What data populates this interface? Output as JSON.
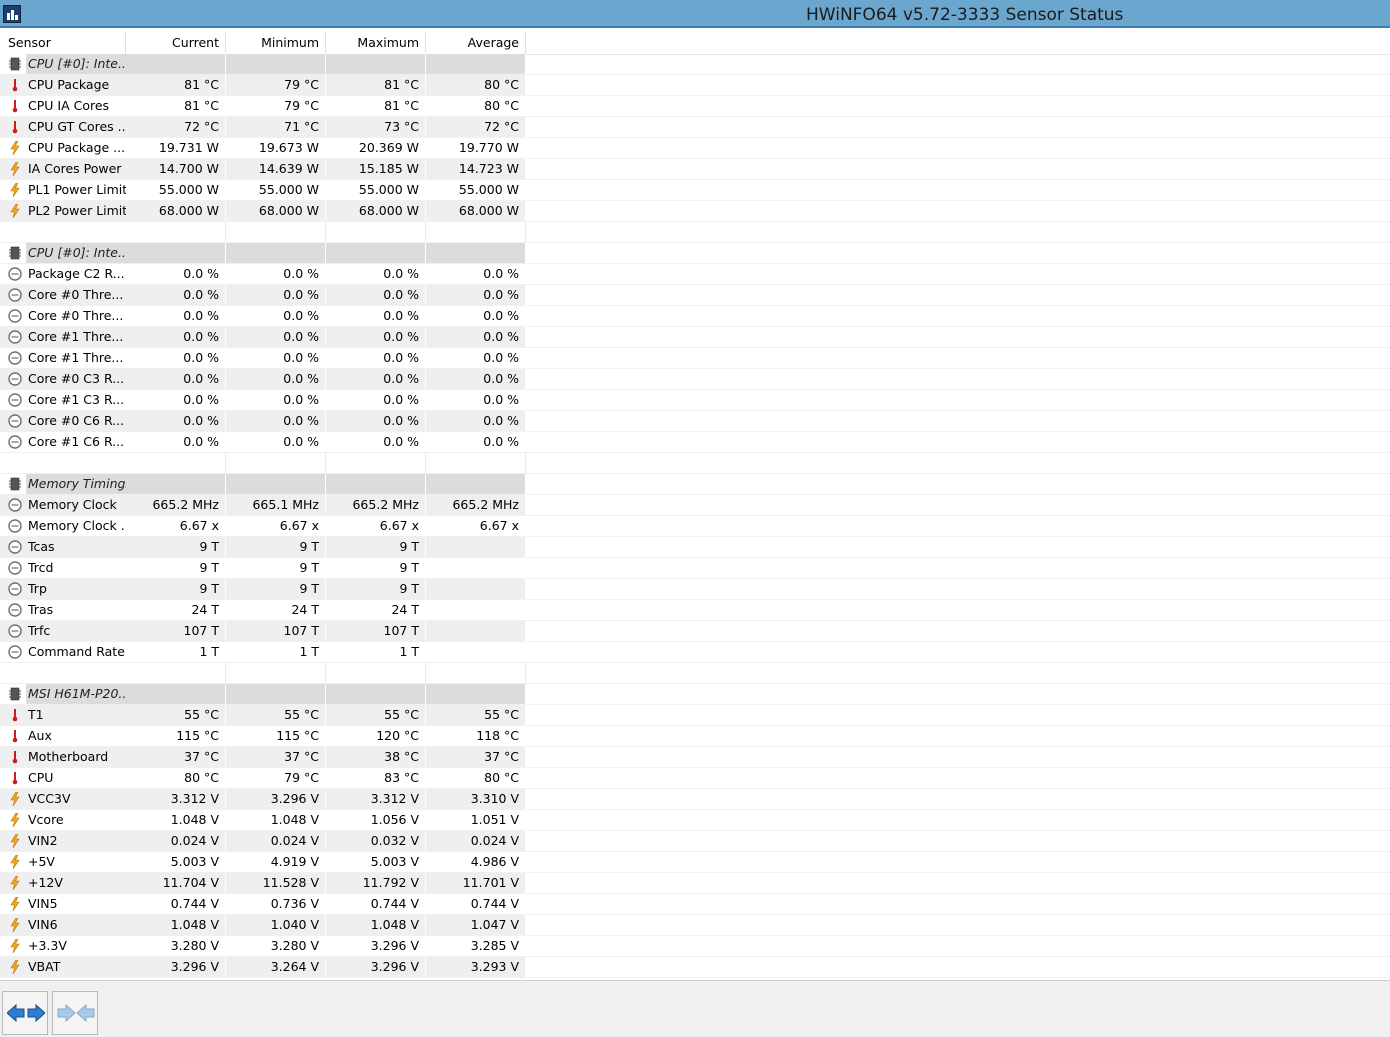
{
  "window": {
    "title": "HWiNFO64 v5.72-3333 Sensor Status",
    "icon": "hwinfo-app-icon"
  },
  "columns": {
    "sensor": "Sensor",
    "current": "Current",
    "minimum": "Minimum",
    "maximum": "Maximum",
    "average": "Average"
  },
  "colors": {
    "titlebar": "#6ba6cf",
    "group_row": "#dcdcdc",
    "alt_row": "#efefef",
    "temp_icon": "#c81e1e",
    "volt_icon": "#f2a81d",
    "clock_icon": "#6f6f6f"
  },
  "rows": [
    {
      "kind": "group",
      "icon": "chip-icon",
      "label": "CPU [#0]: Inte..."
    },
    {
      "kind": "data",
      "icon": "thermometer-icon",
      "label": "CPU Package",
      "current": "81 °C",
      "minimum": "79 °C",
      "maximum": "81 °C",
      "average": "80 °C"
    },
    {
      "kind": "data",
      "icon": "thermometer-icon",
      "label": "CPU IA Cores",
      "current": "81 °C",
      "minimum": "79 °C",
      "maximum": "81 °C",
      "average": "80 °C"
    },
    {
      "kind": "data",
      "icon": "thermometer-icon",
      "label": "CPU GT Cores ...",
      "current": "72 °C",
      "minimum": "71 °C",
      "maximum": "73 °C",
      "average": "72 °C"
    },
    {
      "kind": "data",
      "icon": "lightning-icon",
      "label": "CPU Package ...",
      "current": "19.731 W",
      "minimum": "19.673 W",
      "maximum": "20.369 W",
      "average": "19.770 W"
    },
    {
      "kind": "data",
      "icon": "lightning-icon",
      "label": "IA Cores Power",
      "current": "14.700 W",
      "minimum": "14.639 W",
      "maximum": "15.185 W",
      "average": "14.723 W"
    },
    {
      "kind": "data",
      "icon": "lightning-icon",
      "label": "PL1 Power Limit",
      "current": "55.000 W",
      "minimum": "55.000 W",
      "maximum": "55.000 W",
      "average": "55.000 W"
    },
    {
      "kind": "data",
      "icon": "lightning-icon",
      "label": "PL2 Power Limit",
      "current": "68.000 W",
      "minimum": "68.000 W",
      "maximum": "68.000 W",
      "average": "68.000 W"
    },
    {
      "kind": "blank"
    },
    {
      "kind": "group",
      "icon": "chip-icon",
      "label": "CPU [#0]: Inte..."
    },
    {
      "kind": "data",
      "icon": "clock-icon",
      "label": "Package C2 R...",
      "current": "0.0 %",
      "minimum": "0.0 %",
      "maximum": "0.0 %",
      "average": "0.0 %"
    },
    {
      "kind": "data",
      "icon": "clock-icon",
      "label": "Core #0 Thre...",
      "current": "0.0 %",
      "minimum": "0.0 %",
      "maximum": "0.0 %",
      "average": "0.0 %"
    },
    {
      "kind": "data",
      "icon": "clock-icon",
      "label": "Core #0 Thre...",
      "current": "0.0 %",
      "minimum": "0.0 %",
      "maximum": "0.0 %",
      "average": "0.0 %"
    },
    {
      "kind": "data",
      "icon": "clock-icon",
      "label": "Core #1 Thre...",
      "current": "0.0 %",
      "minimum": "0.0 %",
      "maximum": "0.0 %",
      "average": "0.0 %"
    },
    {
      "kind": "data",
      "icon": "clock-icon",
      "label": "Core #1 Thre...",
      "current": "0.0 %",
      "minimum": "0.0 %",
      "maximum": "0.0 %",
      "average": "0.0 %"
    },
    {
      "kind": "data",
      "icon": "clock-icon",
      "label": "Core #0 C3 R...",
      "current": "0.0 %",
      "minimum": "0.0 %",
      "maximum": "0.0 %",
      "average": "0.0 %"
    },
    {
      "kind": "data",
      "icon": "clock-icon",
      "label": "Core #1 C3 R...",
      "current": "0.0 %",
      "minimum": "0.0 %",
      "maximum": "0.0 %",
      "average": "0.0 %"
    },
    {
      "kind": "data",
      "icon": "clock-icon",
      "label": "Core #0 C6 R...",
      "current": "0.0 %",
      "minimum": "0.0 %",
      "maximum": "0.0 %",
      "average": "0.0 %"
    },
    {
      "kind": "data",
      "icon": "clock-icon",
      "label": "Core #1 C6 R...",
      "current": "0.0 %",
      "minimum": "0.0 %",
      "maximum": "0.0 %",
      "average": "0.0 %"
    },
    {
      "kind": "blank"
    },
    {
      "kind": "group",
      "icon": "chip-icon",
      "label": "Memory Timings"
    },
    {
      "kind": "data",
      "icon": "clock-icon",
      "label": "Memory Clock",
      "current": "665.2 MHz",
      "minimum": "665.1 MHz",
      "maximum": "665.2 MHz",
      "average": "665.2 MHz"
    },
    {
      "kind": "data",
      "icon": "clock-icon",
      "label": "Memory Clock ...",
      "current": "6.67 x",
      "minimum": "6.67 x",
      "maximum": "6.67 x",
      "average": "6.67 x"
    },
    {
      "kind": "data",
      "icon": "clock-icon",
      "label": "Tcas",
      "current": "9 T",
      "minimum": "9 T",
      "maximum": "9 T",
      "average": ""
    },
    {
      "kind": "data",
      "icon": "clock-icon",
      "label": "Trcd",
      "current": "9 T",
      "minimum": "9 T",
      "maximum": "9 T",
      "average": ""
    },
    {
      "kind": "data",
      "icon": "clock-icon",
      "label": "Trp",
      "current": "9 T",
      "minimum": "9 T",
      "maximum": "9 T",
      "average": ""
    },
    {
      "kind": "data",
      "icon": "clock-icon",
      "label": "Tras",
      "current": "24 T",
      "minimum": "24 T",
      "maximum": "24 T",
      "average": ""
    },
    {
      "kind": "data",
      "icon": "clock-icon",
      "label": "Trfc",
      "current": "107 T",
      "minimum": "107 T",
      "maximum": "107 T",
      "average": ""
    },
    {
      "kind": "data",
      "icon": "clock-icon",
      "label": "Command Rate",
      "current": "1 T",
      "minimum": "1 T",
      "maximum": "1 T",
      "average": ""
    },
    {
      "kind": "blank"
    },
    {
      "kind": "group",
      "icon": "chip-icon",
      "label": "MSI H61M-P20..."
    },
    {
      "kind": "data",
      "icon": "thermometer-icon",
      "label": "T1",
      "current": "55 °C",
      "minimum": "55 °C",
      "maximum": "55 °C",
      "average": "55 °C"
    },
    {
      "kind": "data",
      "icon": "thermometer-icon",
      "label": "Aux",
      "current": "115 °C",
      "minimum": "115 °C",
      "maximum": "120 °C",
      "average": "118 °C"
    },
    {
      "kind": "data",
      "icon": "thermometer-icon",
      "label": "Motherboard",
      "current": "37 °C",
      "minimum": "37 °C",
      "maximum": "38 °C",
      "average": "37 °C"
    },
    {
      "kind": "data",
      "icon": "thermometer-icon",
      "label": "CPU",
      "current": "80 °C",
      "minimum": "79 °C",
      "maximum": "83 °C",
      "average": "80 °C"
    },
    {
      "kind": "data",
      "icon": "lightning-icon",
      "label": "VCC3V",
      "current": "3.312 V",
      "minimum": "3.296 V",
      "maximum": "3.312 V",
      "average": "3.310 V"
    },
    {
      "kind": "data",
      "icon": "lightning-icon",
      "label": "Vcore",
      "current": "1.048 V",
      "minimum": "1.048 V",
      "maximum": "1.056 V",
      "average": "1.051 V"
    },
    {
      "kind": "data",
      "icon": "lightning-icon",
      "label": "VIN2",
      "current": "0.024 V",
      "minimum": "0.024 V",
      "maximum": "0.032 V",
      "average": "0.024 V"
    },
    {
      "kind": "data",
      "icon": "lightning-icon",
      "label": "+5V",
      "current": "5.003 V",
      "minimum": "4.919 V",
      "maximum": "5.003 V",
      "average": "4.986 V"
    },
    {
      "kind": "data",
      "icon": "lightning-icon",
      "label": "+12V",
      "current": "11.704 V",
      "minimum": "11.528 V",
      "maximum": "11.792 V",
      "average": "11.701 V"
    },
    {
      "kind": "data",
      "icon": "lightning-icon",
      "label": "VIN5",
      "current": "0.744 V",
      "minimum": "0.736 V",
      "maximum": "0.744 V",
      "average": "0.744 V"
    },
    {
      "kind": "data",
      "icon": "lightning-icon",
      "label": "VIN6",
      "current": "1.048 V",
      "minimum": "1.040 V",
      "maximum": "1.048 V",
      "average": "1.047 V"
    },
    {
      "kind": "data",
      "icon": "lightning-icon",
      "label": "+3.3V",
      "current": "3.280 V",
      "minimum": "3.280 V",
      "maximum": "3.296 V",
      "average": "3.285 V"
    },
    {
      "kind": "data",
      "icon": "lightning-icon",
      "label": "VBAT",
      "current": "3.296 V",
      "minimum": "3.264 V",
      "maximum": "3.296 V",
      "average": "3.293 V"
    }
  ],
  "statusbar": {
    "buttons": [
      {
        "name": "expand-collapse-button",
        "icon": "double-arrow-outward-icon",
        "active": true
      },
      {
        "name": "reset-layout-button",
        "icon": "double-arrow-inward-icon",
        "active": false
      }
    ]
  }
}
